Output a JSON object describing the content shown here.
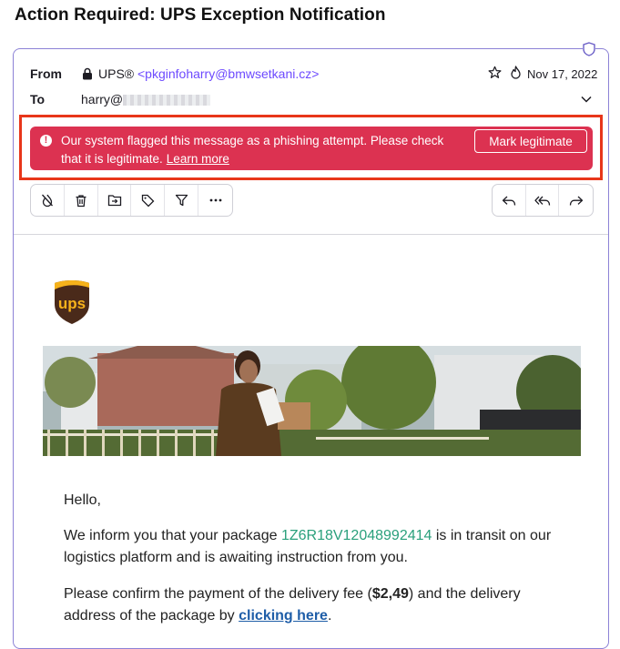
{
  "page": {
    "title": "Action Required: UPS Exception Notification"
  },
  "header": {
    "from_label": "From",
    "sender_name": "UPS®",
    "sender_email": "<pkginfoharry@bmwsetkani.cz>",
    "to_label": "To",
    "recipient": "harry@",
    "date": "Nov 17, 2022"
  },
  "banner": {
    "message": "Our system flagged this message as a phishing attempt. Please check that it is legitimate.",
    "link_label": "Learn more",
    "button_label": "Mark legitimate",
    "color": "#dc3251"
  },
  "toolbar": {
    "left_icons": [
      "not-spam-icon",
      "trash-icon",
      "move-to-folder-icon",
      "label-icon",
      "filter-icon",
      "more-icon"
    ],
    "right_icons": [
      "reply-icon",
      "reply-all-icon",
      "forward-icon"
    ]
  },
  "email": {
    "logo_text": "ups",
    "greeting": "Hello,",
    "p1_before": "We inform you that your package ",
    "tracking_number": "1Z6R18V12048992414",
    "p1_after": " is in transit on our logistics platform and is awaiting instruction from you.",
    "p2_before": "Please confirm the payment of the delivery fee (",
    "fee": "$2,49",
    "p2_middle": ") and the delivery address of the package by ",
    "link_text": "clicking here",
    "p2_after": "."
  },
  "colors": {
    "accent": "#6d4aff",
    "alert_outline": "#e8361a",
    "tracking": "#2aa07c",
    "ups_brown": "#4a2a1a",
    "ups_gold": "#f6b21b"
  }
}
